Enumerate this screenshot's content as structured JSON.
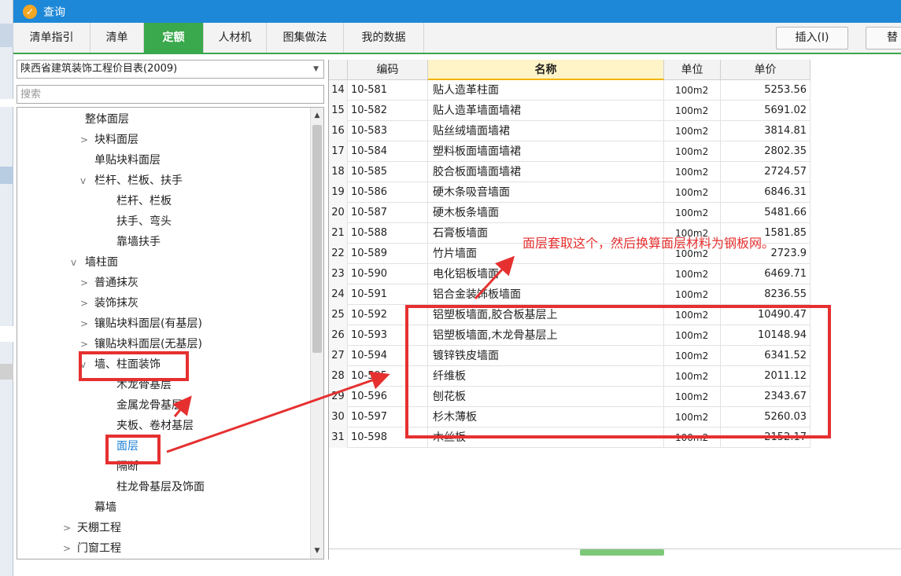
{
  "window": {
    "title": "查询",
    "icon": "app-icon"
  },
  "tabs": [
    {
      "label": "清单指引",
      "active": false
    },
    {
      "label": "清单",
      "active": false
    },
    {
      "label": "定额",
      "active": true
    },
    {
      "label": "人材机",
      "active": false
    },
    {
      "label": "图集做法",
      "active": false
    },
    {
      "label": "我的数据",
      "active": false
    }
  ],
  "toolbar": {
    "insert_label": "插入(I)",
    "replace_label": "替"
  },
  "library": {
    "selected": "陕西省建筑装饰工程价目表(2009)"
  },
  "search": {
    "placeholder": "搜索"
  },
  "tree": [
    {
      "label": "整体面层",
      "chevron": ""
    },
    {
      "label": "块料面层",
      "chevron": ">"
    },
    {
      "label": "单贴块料面层",
      "chevron": ""
    },
    {
      "label": "栏杆、栏板、扶手",
      "chevron": "v"
    },
    {
      "label": "栏杆、栏板",
      "chevron": ""
    },
    {
      "label": "扶手、弯头",
      "chevron": ""
    },
    {
      "label": "靠墙扶手",
      "chevron": ""
    },
    {
      "label": "墙柱面",
      "chevron": "v"
    },
    {
      "label": "普通抹灰",
      "chevron": ">"
    },
    {
      "label": "装饰抹灰",
      "chevron": ">"
    },
    {
      "label": "镶贴块料面层(有基层)",
      "chevron": ">"
    },
    {
      "label": "镶贴块料面层(无基层)",
      "chevron": ">"
    },
    {
      "label": "墙、柱面装饰",
      "chevron": "v"
    },
    {
      "label": "木龙骨基层",
      "chevron": ""
    },
    {
      "label": "金属龙骨基层",
      "chevron": ""
    },
    {
      "label": "夹板、卷材基层",
      "chevron": ""
    },
    {
      "label": "面层",
      "chevron": "",
      "selected": true
    },
    {
      "label": "隔断",
      "chevron": ""
    },
    {
      "label": "柱龙骨基层及饰面",
      "chevron": ""
    },
    {
      "label": "幕墙",
      "chevron": ""
    },
    {
      "label": "天棚工程",
      "chevron": ">"
    },
    {
      "label": "门窗工程",
      "chevron": ">"
    }
  ],
  "grid": {
    "columns": [
      "编码",
      "名称",
      "单位",
      "单价"
    ],
    "rows": [
      {
        "n": "14",
        "code": "10-581",
        "name": "贴人造革柱面",
        "unit": "100m2",
        "price": "5253.56"
      },
      {
        "n": "15",
        "code": "10-582",
        "name": "贴人造革墙面墙裙",
        "unit": "100m2",
        "price": "5691.02"
      },
      {
        "n": "16",
        "code": "10-583",
        "name": "贴丝绒墙面墙裙",
        "unit": "100m2",
        "price": "3814.81"
      },
      {
        "n": "17",
        "code": "10-584",
        "name": "塑料板面墙面墙裙",
        "unit": "100m2",
        "price": "2802.35"
      },
      {
        "n": "18",
        "code": "10-585",
        "name": "胶合板面墙面墙裙",
        "unit": "100m2",
        "price": "2724.57"
      },
      {
        "n": "19",
        "code": "10-586",
        "name": "硬木条吸音墙面",
        "unit": "100m2",
        "price": "6846.31"
      },
      {
        "n": "20",
        "code": "10-587",
        "name": "硬木板条墙面",
        "unit": "100m2",
        "price": "5481.66"
      },
      {
        "n": "21",
        "code": "10-588",
        "name": "石膏板墙面",
        "unit": "100m2",
        "price": "1581.85"
      },
      {
        "n": "22",
        "code": "10-589",
        "name": "竹片墙面",
        "unit": "100m2",
        "price": "2723.9"
      },
      {
        "n": "23",
        "code": "10-590",
        "name": "电化铝板墙面",
        "unit": "100m2",
        "price": "6469.71"
      },
      {
        "n": "24",
        "code": "10-591",
        "name": "铝合金装饰板墙面",
        "unit": "100m2",
        "price": "8236.55"
      },
      {
        "n": "25",
        "code": "10-592",
        "name": "铝塑板墙面,胶合板基层上",
        "unit": "100m2",
        "price": "10490.47"
      },
      {
        "n": "26",
        "code": "10-593",
        "name": "铝塑板墙面,木龙骨基层上",
        "unit": "100m2",
        "price": "10148.94"
      },
      {
        "n": "27",
        "code": "10-594",
        "name": "镀锌铁皮墙面",
        "unit": "100m2",
        "price": "6341.52"
      },
      {
        "n": "28",
        "code": "10-595",
        "name": "纤维板",
        "unit": "100m2",
        "price": "2011.12"
      },
      {
        "n": "29",
        "code": "10-596",
        "name": "刨花板",
        "unit": "100m2",
        "price": "2343.67"
      },
      {
        "n": "30",
        "code": "10-597",
        "name": "杉木薄板",
        "unit": "100m2",
        "price": "5260.03"
      },
      {
        "n": "31",
        "code": "10-598",
        "name": "木丝板",
        "unit": "100m2",
        "price": "2152.17"
      }
    ]
  },
  "annotation": {
    "text": "面层套取这个，然后换算面层材料为钢板网。"
  },
  "colors": {
    "title_bar": "#1e88d8",
    "active_tab": "#3aa84c",
    "annotation": "#e63030",
    "name_header": "#fff4c8"
  }
}
